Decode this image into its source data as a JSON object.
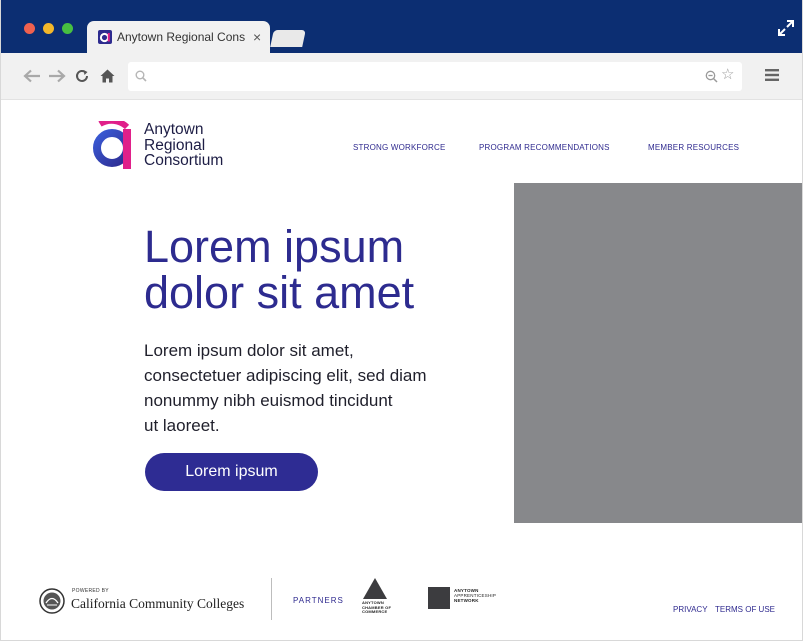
{
  "browser": {
    "tab_title": "Anytown Regional Cons",
    "tab_close": "×",
    "url_value": "",
    "url_placeholder": ""
  },
  "site": {
    "logo_lines": [
      "Anytown",
      "Regional",
      "Consortium"
    ],
    "nav": [
      "STRONG WORKFORCE",
      "PROGRAM RECOMMENDATIONS",
      "MEMBER RESOURCES"
    ]
  },
  "hero": {
    "title_lines": [
      "Lorem ipsum",
      "dolor sit amet"
    ],
    "body_lines": [
      "Lorem ipsum dolor sit amet,",
      "consectetuer adipiscing elit, sed diam",
      "nonummy nibh euismod tincidunt",
      "ut laoreet."
    ],
    "button_label": "Lorem ipsum"
  },
  "footer": {
    "powered_by": "POWERED BY",
    "ccc_name": "California Community Colleges",
    "partners_label": "PARTNERS",
    "chamber_lines": [
      "ANYTOWN",
      "CHAMBER OF",
      "COMMERCE"
    ],
    "apprentice_lines": [
      "ANYTOWN",
      "APPRENTICESHIP",
      "NETWORK"
    ],
    "links": [
      "PRIVACY",
      "TERMS OF USE"
    ]
  },
  "colors": {
    "titlebar": "#0c2e72",
    "brand_purple": "#2d2b8f",
    "logo_blue": "#3a5bd6",
    "logo_magenta": "#e0208a",
    "hero_image": "#87888b"
  },
  "icons": [
    "back-arrow-icon",
    "forward-arrow-icon",
    "reload-icon",
    "home-icon",
    "search-icon",
    "zoom-icon",
    "star-icon",
    "menu-icon",
    "expand-icon"
  ]
}
